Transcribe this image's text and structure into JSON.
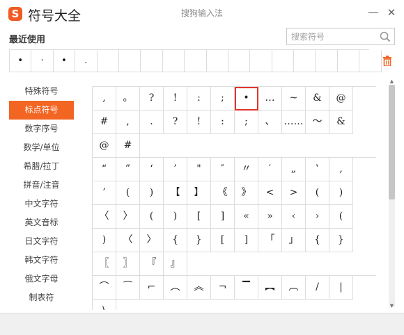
{
  "window": {
    "logo_letter": "S",
    "app_title": "符号大全",
    "center_title": "搜狗输入法",
    "minimize_glyph": "—",
    "close_glyph": "✕"
  },
  "recent": {
    "label": "最近使用",
    "search_placeholder": "搜索符号",
    "symbols": [
      "•",
      "·",
      "•",
      ".",
      "",
      "",
      "",
      "",
      "",
      "",
      "",
      "",
      "",
      "",
      "",
      "",
      ""
    ]
  },
  "sidebar": {
    "items": [
      {
        "label": "特殊符号",
        "active": false
      },
      {
        "label": "标点符号",
        "active": true
      },
      {
        "label": "数字序号",
        "active": false
      },
      {
        "label": "数学/单位",
        "active": false
      },
      {
        "label": "希腊/拉丁",
        "active": false
      },
      {
        "label": "拼音/注音",
        "active": false
      },
      {
        "label": "中文字符",
        "active": false
      },
      {
        "label": "英文音标",
        "active": false
      },
      {
        "label": "日文字符",
        "active": false
      },
      {
        "label": "韩文字符",
        "active": false
      },
      {
        "label": "俄文字母",
        "active": false
      },
      {
        "label": "制表符",
        "active": false
      }
    ]
  },
  "grid": {
    "selected_symbol": "•",
    "block_a": [
      ",",
      "。",
      "?",
      "!",
      ":",
      ";",
      "•",
      "…",
      "~",
      "&",
      "@",
      "#",
      ",",
      ".",
      "?",
      "!",
      ":",
      ";",
      "、",
      "……",
      "～",
      "&",
      "@",
      "#"
    ],
    "block_b": [
      "“",
      "”",
      "‘",
      "’",
      "\"",
      "″",
      "〃",
      "′",
      "„",
      "‛",
      "‚",
      "’",
      "(",
      ")",
      "【",
      "】",
      "《",
      "》",
      "<",
      ">",
      "(",
      ")",
      "〈",
      "〉",
      "(",
      ")",
      "[",
      "]",
      "«",
      "»",
      "‹",
      "›",
      "(",
      ")",
      "〈",
      "〉",
      "{",
      "}",
      "[",
      "]",
      "「",
      "」",
      "{",
      "}",
      "〖",
      "〗",
      "『",
      "』"
    ],
    "block_c": [
      "⌒",
      "⁀",
      "⌐",
      "︵",
      "︽",
      "¬",
      "▔",
      "︻",
      "︹",
      "/",
      "|",
      "\\"
    ]
  }
}
